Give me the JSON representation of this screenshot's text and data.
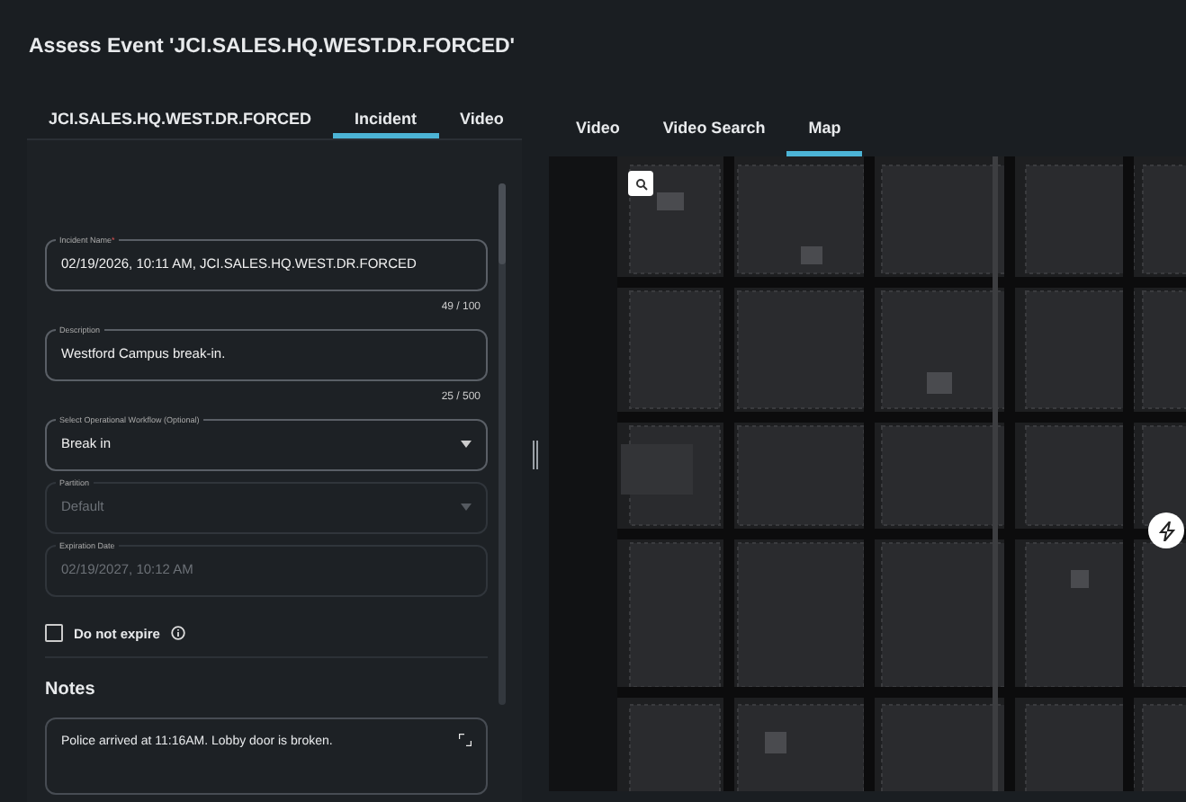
{
  "title": "Assess Event 'JCI.SALES.HQ.WEST.DR.FORCED'",
  "left_tabs": [
    {
      "label": "JCI.SALES.HQ.WEST.DR.FORCED",
      "selected": false
    },
    {
      "label": "Incident",
      "selected": true
    },
    {
      "label": "Video",
      "selected": false
    }
  ],
  "fields": [
    {
      "kind": "text",
      "label": "Incident Name",
      "required_mark": "*",
      "value": "02/19/2026, 10:11 AM, JCI.SALES.HQ.WEST.DR.FORCED",
      "counter": "49 / 100",
      "disabled": false
    },
    {
      "kind": "text",
      "label": "Description",
      "value": "Westford Campus break-in.",
      "counter": "25 / 500",
      "disabled": false
    },
    {
      "kind": "select",
      "label": "Select Operational Workflow (Optional)",
      "value": "Break in",
      "disabled": false
    },
    {
      "kind": "select",
      "label": "Partition",
      "value": "Default",
      "disabled": true
    },
    {
      "kind": "text",
      "label": "Expiration Date",
      "value": "02/19/2027, 10:12 AM",
      "disabled": true
    }
  ],
  "do_not_expire": {
    "label": "Do not expire",
    "checked": false
  },
  "notes": {
    "heading": "Notes",
    "value": "Police arrived at 11:16AM. Lobby door is broken."
  },
  "right_tabs": [
    {
      "label": "Video",
      "selected": false
    },
    {
      "label": "Video Search",
      "selected": false
    },
    {
      "label": "Map",
      "selected": true
    }
  ]
}
